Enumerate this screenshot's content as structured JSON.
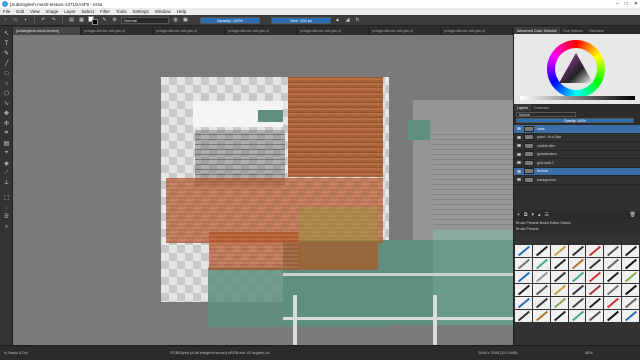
{
  "window": {
    "title": "[Subsinglesh-mesh-texture-1371DA4F5 - Krita"
  },
  "menu": [
    "File",
    "Edit",
    "View",
    "Image",
    "Layer",
    "Select",
    "Filter",
    "Tools",
    "Settings",
    "Window",
    "Help"
  ],
  "toolbar": {
    "blend_mode": "Normal",
    "opacity": "Opacity: 100%",
    "size": "Size: 100 px"
  },
  "tabs": [
    "[subsinglesh-mesh-texture]",
    "pelagic-kiln-ter-xsb-yse-yt",
    "pelagic-kiln-ter-xsb-yse-yt",
    "pelagic-kiln-ter-xsb-yse-yt",
    "pelagic-kiln-ter-xsb-yse-yt",
    "pelagic-kiln-ter-xsb-yse-yt",
    "pelagic-kiln-ter-xsb-yse-yt"
  ],
  "right_panel": {
    "top_tabs": [
      "Advanced Color Selector",
      "Tool Options",
      "Overview"
    ],
    "layers_tabs": [
      "Layers",
      "Channels"
    ],
    "blend": "Normal",
    "opacity": "Opacity: 100%",
    "layers": [
      {
        "name": "cabs",
        "selected": true
      },
      {
        "name": "paint · hi-v-2da",
        "selected": false
      },
      {
        "name": "cobble-tiles",
        "selected": false
      },
      {
        "name": "grassbottom",
        "selected": false
      },
      {
        "name": "grid-wall-2",
        "selected": false
      },
      {
        "name": "texture",
        "selected": true
      },
      {
        "name": "background",
        "selected": false
      }
    ],
    "brush_tabs": "Brush Presets     Brush Editor Status",
    "brush_filter": "Brush Presets"
  },
  "status": {
    "left": "b) Basic-5 Dry",
    "middle": "RGB/Alpha (8-bit integer/channel)  sRGB-elle-V2-srgbtrc.icc",
    "right": "2048 x 2048 (32.0 MiB)",
    "zoom": "46%"
  }
}
